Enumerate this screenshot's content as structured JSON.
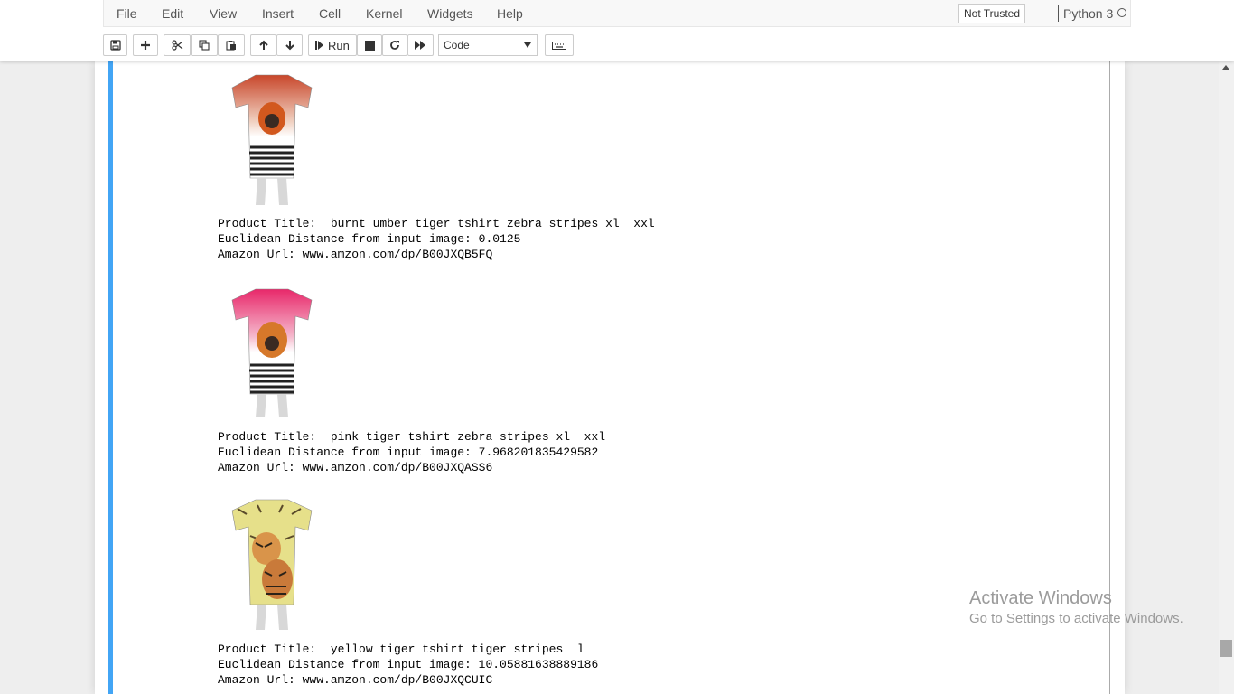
{
  "menubar": {
    "items": [
      "File",
      "Edit",
      "View",
      "Insert",
      "Cell",
      "Kernel",
      "Widgets",
      "Help"
    ],
    "trust_status": "Not Trusted",
    "kernel_name": "Python 3"
  },
  "toolbar": {
    "run_label": "Run",
    "cell_type": "Code",
    "icons": [
      "save-icon",
      "plus-icon",
      "cut-icon",
      "copy-icon",
      "paste-icon",
      "arrow-up-icon",
      "arrow-down-icon",
      "stop-icon",
      "restart-icon",
      "fast-forward-icon",
      "keyboard-icon"
    ]
  },
  "outputs": [
    {
      "image": "red-orange tiger t-shirt with zebra stripes",
      "title_line": "Product Title:  burnt umber tiger tshirt zebra stripes xl  xxl",
      "distance_line": "Euclidean Distance from input image: 0.0125",
      "url_line": "Amazon Url: www.amzon.com/dp/B00JXQB5FQ",
      "colors": {
        "top": "#c8462a",
        "mid": "#f0d0c0"
      }
    },
    {
      "image": "pink tiger t-shirt with zebra stripes",
      "title_line": "Product Title:  pink tiger tshirt zebra stripes xl  xxl",
      "distance_line": "Euclidean Distance from input image: 7.968201835429582",
      "url_line": "Amazon Url: www.amzon.com/dp/B00JXQASS6",
      "colors": {
        "top": "#e8286a",
        "mid": "#f5b8cc"
      }
    },
    {
      "image": "yellow tiger t-shirt with tiger stripes",
      "title_line": "Product Title:  yellow tiger tshirt tiger stripes  l",
      "distance_line": "Euclidean Distance from input image: 10.05881638889186",
      "url_line": "Amazon Url: www.amzon.com/dp/B00JXQCUIC",
      "colors": {
        "top": "#e6e08a",
        "mid": "#d9944a"
      }
    }
  ],
  "watermark": {
    "title": "Activate Windows",
    "subtitle": "Go to Settings to activate Windows."
  },
  "colors": {
    "cell_bar": "#42a5f5",
    "menubar_bg": "#f8f8f8",
    "page_bg": "#eeeeee"
  }
}
